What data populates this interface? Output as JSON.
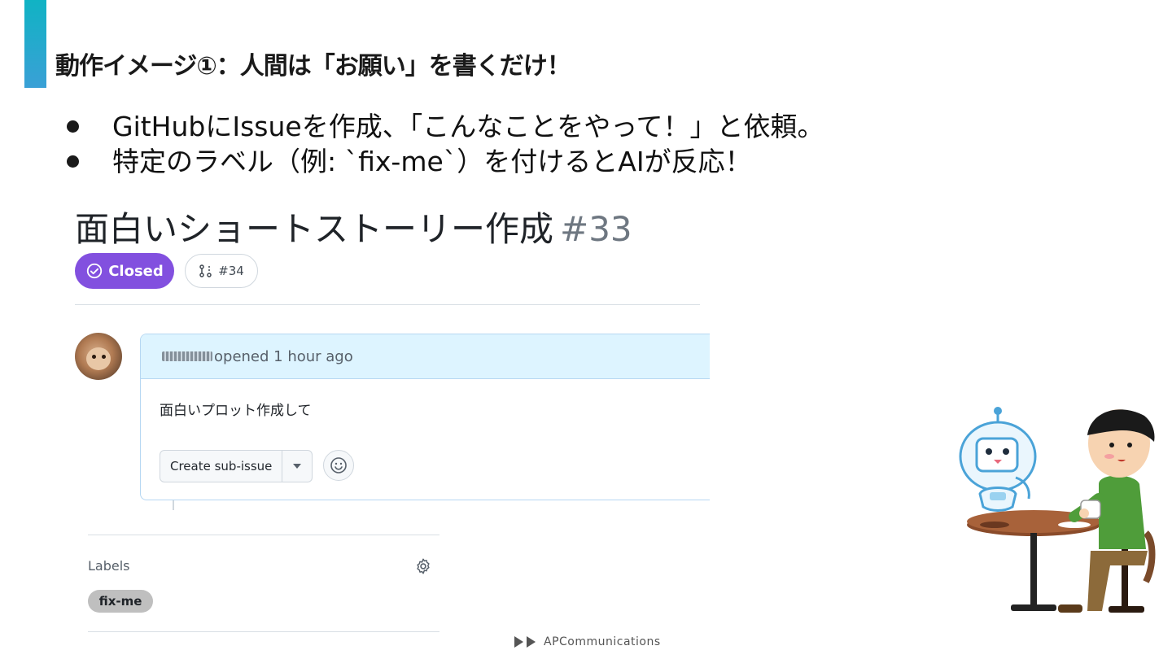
{
  "slide": {
    "title": "動作イメージ①：人間は「お願い」を書くだけ！",
    "bullets": [
      "GitHubにIssueを作成、「こんなことをやって！」と依頼。",
      "特定のラベル（例: `fix-me`）を付けるとAIが反応！"
    ]
  },
  "issue": {
    "title": "面白いショートストーリー作成",
    "number": "#33",
    "state": "Closed",
    "linked_pr": "#34",
    "comment": {
      "action": "opened 1 hour ago",
      "body": "面白いプロット作成して",
      "create_sub_issue": "Create sub-issue"
    },
    "sidebar": {
      "labels_heading": "Labels",
      "labels": [
        "fix-me"
      ]
    }
  },
  "footer": {
    "brand": "APCommunications"
  },
  "colors": {
    "accent": "#10b3c4",
    "closed_badge": "#8250df",
    "comment_header": "#ddf4ff",
    "label_chip": "#bfbfbf"
  }
}
